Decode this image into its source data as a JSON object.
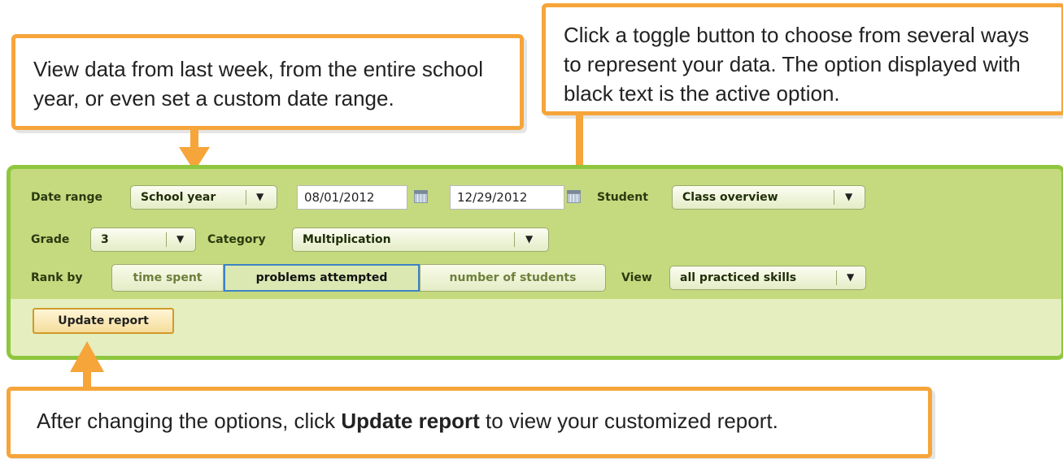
{
  "callouts": {
    "date_range": "View data from last week, from the entire school year, or even set a custom date range.",
    "toggle": "Click a toggle button to choose from several ways to represent your data. The option displayed with black text is the active option.",
    "update_prefix": "After changing the options, click ",
    "update_bold": "Update report",
    "update_suffix": " to view your customized report."
  },
  "filters": {
    "date_range_label": "Date range",
    "date_range_value": "School year",
    "start_date": "08/01/2012",
    "end_date": "12/29/2012",
    "student_label": "Student",
    "student_value": "Class overview",
    "grade_label": "Grade",
    "grade_value": "3",
    "category_label": "Category",
    "category_value": "Multiplication",
    "rank_by_label": "Rank by",
    "rank_options": [
      "time spent",
      "problems attempted",
      "number of students"
    ],
    "rank_active": "problems attempted",
    "view_label": "View",
    "view_value": "all practiced skills",
    "update_button": "Update report"
  },
  "colors": {
    "callout_border": "#f6a53a",
    "panel_border": "#8fc63f",
    "panel_bg": "#c5da7e",
    "active_toggle_border": "#3d83c4"
  }
}
